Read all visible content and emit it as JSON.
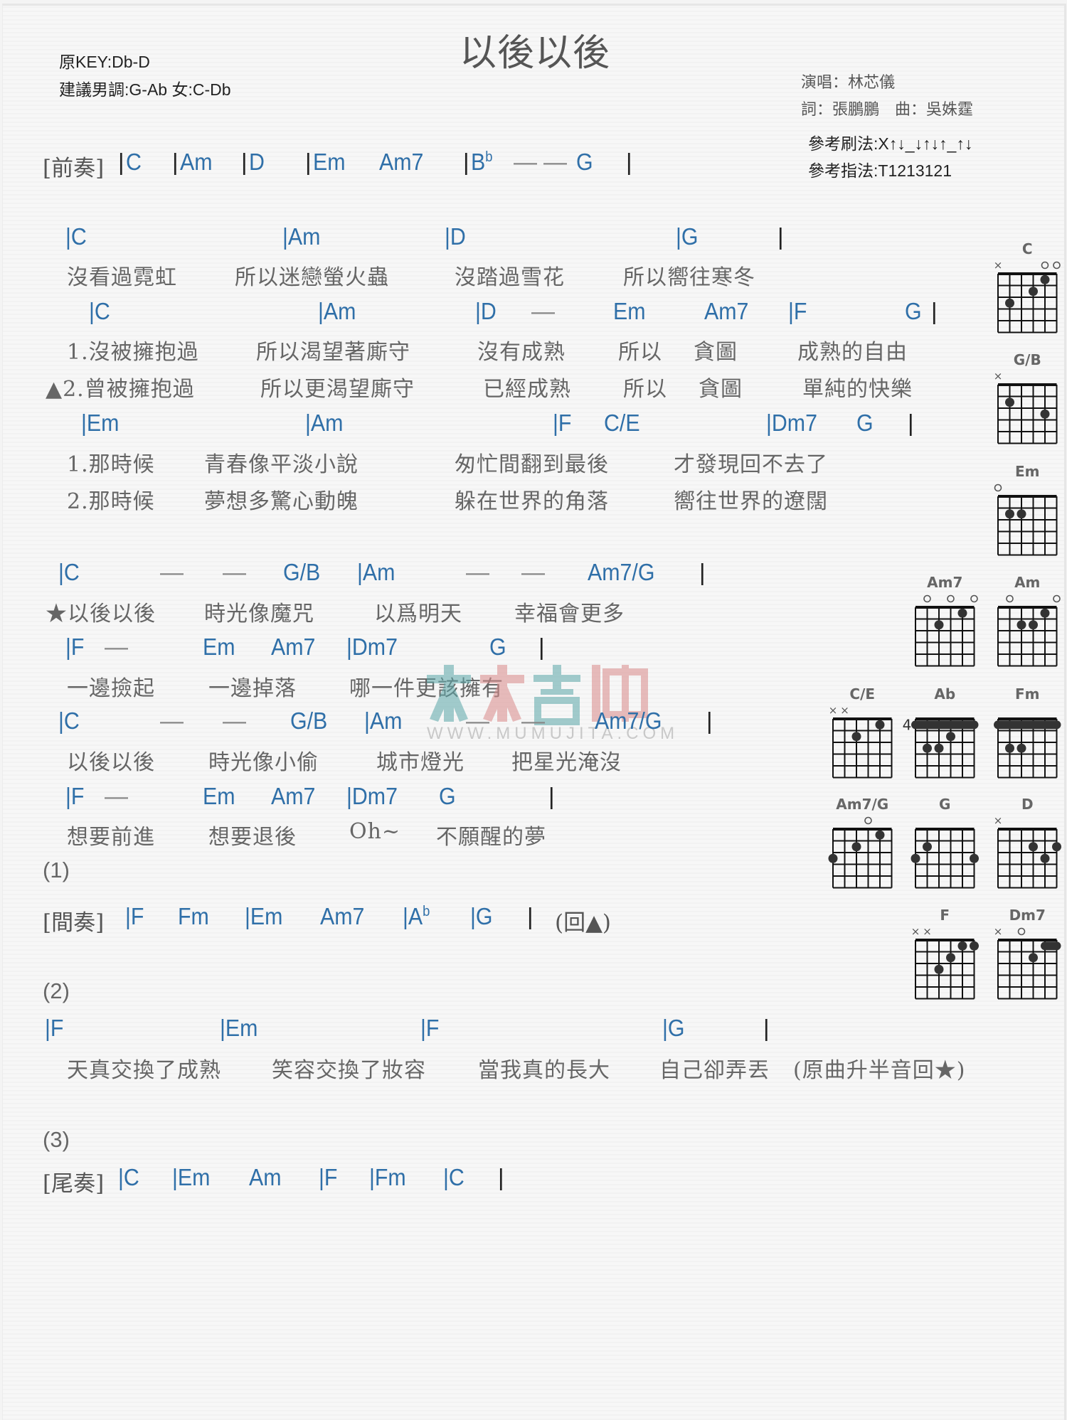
{
  "title": "以後以後",
  "key_info": {
    "original_key": "原KEY:Db-D",
    "suggested_key": "建議男調:G-Ab 女:C-Db"
  },
  "credits": {
    "singer": "演唱：林芯儀",
    "lyricist_composer": "詞：張鵬鵬　曲：吳姝霆",
    "strum_pattern": "參考刷法:X↑↓_↓↑↓↑_↑↓",
    "finger_pattern": "參考指法:T1213121"
  },
  "watermark": {
    "brand": "木木吉他",
    "url": "WWW.MUMUJITA.COM",
    "colors": [
      "#5aa7a8",
      "#d98a8a"
    ]
  },
  "colors": {
    "chord": "#2f6fa8",
    "lyric": "#666666",
    "bar": "#222222"
  },
  "sheet": {
    "intro": {
      "label": "[前奏]",
      "tokens": [
        {
          "t": "bar",
          "v": "|"
        },
        {
          "t": "chord",
          "v": "C"
        },
        {
          "t": "bar",
          "v": "|"
        },
        {
          "t": "chord",
          "v": "Am"
        },
        {
          "t": "bar",
          "v": "|"
        },
        {
          "t": "chord",
          "v": "D"
        },
        {
          "t": "bar",
          "v": "|"
        },
        {
          "t": "chord",
          "v": "Em"
        },
        {
          "t": "chord",
          "v": "Am7"
        },
        {
          "t": "bar",
          "v": "|"
        },
        {
          "t": "chord",
          "v": "B",
          "sup": "b"
        },
        {
          "t": "dash",
          "v": "—"
        },
        {
          "t": "dash",
          "v": "—"
        },
        {
          "t": "chord",
          "v": "G"
        },
        {
          "t": "bar",
          "v": "|"
        }
      ]
    },
    "verse": {
      "chords1": [
        "|C",
        "|Am",
        "|D",
        "|G",
        "|"
      ],
      "lyrics1": [
        "沒看過霓虹",
        "所以迷戀螢火蟲",
        "沒踏過雪花",
        "所以嚮往寒冬"
      ],
      "chords2": [
        "|C",
        "|Am",
        "|D",
        "—",
        "Em",
        "Am7",
        "|F",
        "G",
        "|"
      ],
      "lyrics2a": [
        "1.沒被擁抱過",
        "所以渴望著廝守",
        "沒有成熟",
        "所以",
        "貪圖",
        "成熟的自由"
      ],
      "lyrics2b": [
        "▲2.曾被擁抱過",
        "所以更渴望廝守",
        "已經成熟",
        "所以",
        "貪圖",
        "單純的快樂"
      ],
      "chords3": [
        "|Em",
        "|Am",
        "|F",
        "C/E",
        "|Dm7",
        "G",
        "|"
      ],
      "lyrics3a": [
        "1.那時候",
        "青春像平淡小說",
        "匆忙間翻到最後",
        "才發現回不去了"
      ],
      "lyrics3b": [
        "2.那時候",
        "夢想多驚心動魄",
        "躲在世界的角落",
        "嚮往世界的遼闊"
      ]
    },
    "chorus": {
      "chords1": [
        "|C",
        "—",
        "—",
        "G/B",
        "|Am",
        "—",
        "—",
        "Am7/G",
        "|"
      ],
      "lyrics1": [
        "★以後以後",
        "時光像魔咒",
        "以爲明天",
        "幸福會更多"
      ],
      "chords2": [
        "|F",
        "—",
        "Em",
        "Am7",
        "|Dm7",
        "G",
        "|"
      ],
      "lyrics2": [
        "一邊撿起",
        "一邊掉落",
        "哪一件更該擁有"
      ],
      "chords3": [
        "|C",
        "—",
        "—",
        "G/B",
        "|Am",
        "—",
        "—",
        "Am7/G",
        "|"
      ],
      "lyrics3": [
        "以後以後",
        "時光像小偷",
        "城市燈光",
        "把星光淹沒"
      ],
      "chords4": [
        "|F",
        "—",
        "Em",
        "Am7",
        "|Dm7",
        "G",
        "|"
      ],
      "lyrics4": [
        "想要前進",
        "想要退後",
        "Oh~",
        "不願醒的夢"
      ]
    },
    "part1": {
      "number": "(1)",
      "label": "[間奏]",
      "chords": [
        "|F",
        "Fm",
        "|Em",
        "Am7",
        "|A",
        "|G",
        "|"
      ],
      "ab_sup": "b",
      "return_mark": "(回▲)"
    },
    "part2": {
      "number": "(2)",
      "chords": [
        "|F",
        "|Em",
        "|F",
        "|G",
        "|"
      ],
      "lyrics": [
        "天真交換了成熟",
        "笑容交換了妝容",
        "當我真的長大",
        "自己卻弄丟",
        "(原曲升半音回★)"
      ]
    },
    "part3": {
      "number": "(3)",
      "label": "[尾奏]",
      "chords": [
        "|C",
        "|Em",
        "Am",
        "|F",
        "|Fm",
        "|C",
        "|"
      ]
    }
  },
  "chord_charts": [
    {
      "name": "C",
      "top": [
        "x",
        "",
        "",
        "",
        "o",
        "o"
      ],
      "barre": null,
      "fret_label": "",
      "dots": [
        [
          5,
          1
        ],
        [
          4,
          2
        ],
        [
          2,
          3
        ]
      ]
    },
    {
      "name": "G/B",
      "top": [
        "x",
        "",
        "",
        "",
        "",
        ""
      ],
      "barre": null,
      "fret_label": "",
      "dots": [
        [
          2,
          2
        ],
        [
          5,
          3
        ]
      ]
    },
    {
      "name": "Em",
      "top": [
        "o",
        "",
        "",
        "",
        "",
        ""
      ],
      "barre": null,
      "fret_label": "",
      "dots": [
        [
          2,
          2
        ],
        [
          3,
          2
        ]
      ]
    },
    {
      "name": "Am7",
      "top": [
        "",
        "o",
        "",
        "o",
        "",
        "o"
      ],
      "barre": null,
      "fret_label": "",
      "dots": [
        [
          5,
          1
        ],
        [
          3,
          2
        ]
      ]
    },
    {
      "name": "Am",
      "top": [
        "",
        "o",
        "",
        "",
        "",
        "o"
      ],
      "barre": null,
      "fret_label": "",
      "dots": [
        [
          5,
          1
        ],
        [
          3,
          2
        ],
        [
          4,
          2
        ]
      ]
    },
    {
      "name": "C/E",
      "top": [
        "x",
        "x",
        "",
        "",
        "",
        ""
      ],
      "barre": null,
      "fret_label": "",
      "dots": [
        [
          5,
          1
        ],
        [
          3,
          2
        ]
      ]
    },
    {
      "name": "Ab",
      "top": [
        "",
        "",
        "",
        "",
        "",
        ""
      ],
      "barre": [
        1,
        1,
        6
      ],
      "fret_label": "4",
      "dots": [
        [
          4,
          2
        ],
        [
          2,
          3
        ],
        [
          3,
          3
        ]
      ]
    },
    {
      "name": "Fm",
      "top": [
        "",
        "",
        "",
        "",
        "",
        ""
      ],
      "barre": [
        1,
        1,
        6
      ],
      "fret_label": "",
      "dots": [
        [
          2,
          3
        ],
        [
          3,
          3
        ]
      ]
    },
    {
      "name": "Am7/G",
      "top": [
        "",
        "",
        "",
        "o",
        "",
        ""
      ],
      "barre": null,
      "fret_label": "",
      "dots": [
        [
          5,
          1
        ],
        [
          3,
          2
        ],
        [
          1,
          3
        ]
      ]
    },
    {
      "name": "G",
      "top": [
        "",
        "",
        "",
        "",
        "",
        ""
      ],
      "barre": null,
      "fret_label": "",
      "dots": [
        [
          2,
          2
        ],
        [
          1,
          3
        ],
        [
          6,
          3
        ]
      ]
    },
    {
      "name": "D",
      "top": [
        "x",
        "",
        "",
        "",
        "",
        ""
      ],
      "barre": null,
      "fret_label": "",
      "dots": [
        [
          4,
          2
        ],
        [
          6,
          2
        ],
        [
          5,
          3
        ]
      ]
    },
    {
      "name": "F",
      "top": [
        "x",
        "x",
        "",
        "",
        "",
        ""
      ],
      "barre": null,
      "fret_label": "",
      "dots": [
        [
          5,
          1
        ],
        [
          6,
          1
        ],
        [
          4,
          2
        ],
        [
          3,
          3
        ]
      ]
    },
    {
      "name": "Dm7",
      "top": [
        "x",
        "",
        "o",
        "",
        "",
        ""
      ],
      "barre": [
        1,
        5,
        6
      ],
      "fret_label": "",
      "dots": [
        [
          4,
          2
        ]
      ]
    }
  ]
}
